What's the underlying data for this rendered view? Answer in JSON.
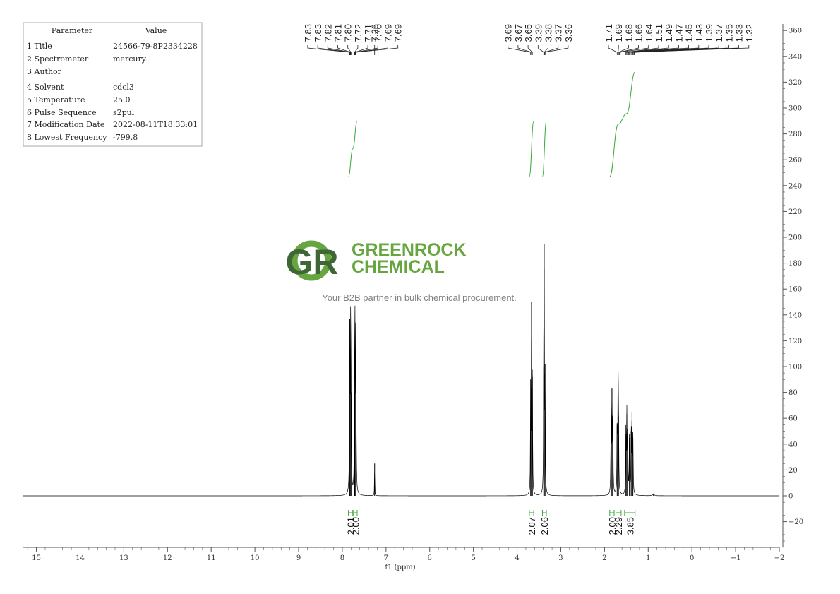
{
  "param_table": {
    "header": [
      "Parameter",
      "Value"
    ],
    "rows": [
      {
        "param": "1 Title",
        "value": "24566-79-8P2334228"
      },
      {
        "param": "2 Spectrometer",
        "value": "mercury"
      },
      {
        "param": "3 Author",
        "value": ""
      },
      {
        "param": "4 Solvent",
        "value": "cdcl3"
      },
      {
        "param": "5 Temperature",
        "value": "25.0"
      },
      {
        "param": "6 Pulse Sequence",
        "value": "s2pul"
      },
      {
        "param": "7 Modification Date",
        "value": "2022-08-11T18:33:01"
      },
      {
        "param": "8 Lowest Frequency",
        "value": "-799.8"
      }
    ]
  },
  "watermark": {
    "logo_letters": "GR",
    "line1": "GREENROCK",
    "line2": "CHEMICAL",
    "tagline": "Your B2B partner in bulk chemical procurement.",
    "green": "#5a9e2f",
    "dark": "#2f5a24"
  },
  "colors": {
    "spectrum": "#000000",
    "integral": "#3aa63a",
    "axis": "#555555"
  },
  "chart_data": {
    "type": "line",
    "title": "",
    "xlabel": "f1 (ppm)",
    "ylabel": "",
    "xlim": [
      15.3,
      -2.0
    ],
    "ylim": [
      -40,
      365
    ],
    "x_ticks": [
      15,
      14,
      13,
      12,
      11,
      10,
      9,
      8,
      7,
      6,
      5,
      4,
      3,
      2,
      1,
      0,
      -1,
      -2
    ],
    "x_tick_labels": [
      "15",
      "14",
      "13",
      "12",
      "11",
      "10",
      "9",
      "8",
      "7",
      "6",
      "5",
      "4",
      "3",
      "2",
      "1",
      "0",
      "−1",
      "−2"
    ],
    "y_ticks": [
      -20,
      0,
      20,
      40,
      60,
      80,
      100,
      120,
      140,
      160,
      180,
      200,
      220,
      240,
      260,
      280,
      300,
      320,
      340,
      360
    ],
    "grid": false,
    "peaks": [
      {
        "ppm": 7.83,
        "h": 137,
        "w": 0.006
      },
      {
        "ppm": 7.81,
        "h": 115,
        "w": 0.006
      },
      {
        "ppm": 7.8,
        "h": 80,
        "w": 0.006
      },
      {
        "ppm": 7.72,
        "h": 80,
        "w": 0.006
      },
      {
        "ppm": 7.71,
        "h": 115,
        "w": 0.006
      },
      {
        "ppm": 7.69,
        "h": 134,
        "w": 0.006
      },
      {
        "ppm": 7.26,
        "h": 25,
        "w": 0.004
      },
      {
        "ppm": 3.69,
        "h": 90,
        "w": 0.005
      },
      {
        "ppm": 3.67,
        "h": 150,
        "w": 0.005
      },
      {
        "ppm": 3.65,
        "h": 92,
        "w": 0.005
      },
      {
        "ppm": 3.39,
        "h": 100,
        "w": 0.005
      },
      {
        "ppm": 3.38,
        "h": 195,
        "w": 0.005
      },
      {
        "ppm": 3.36,
        "h": 102,
        "w": 0.005
      },
      {
        "ppm": 1.85,
        "h": 60,
        "w": 0.006
      },
      {
        "ppm": 1.83,
        "h": 83,
        "w": 0.006
      },
      {
        "ppm": 1.81,
        "h": 62,
        "w": 0.006
      },
      {
        "ppm": 1.71,
        "h": 55,
        "w": 0.006
      },
      {
        "ppm": 1.69,
        "h": 82,
        "w": 0.006
      },
      {
        "ppm": 1.68,
        "h": 62,
        "w": 0.006
      },
      {
        "ppm": 1.51,
        "h": 48,
        "w": 0.006
      },
      {
        "ppm": 1.49,
        "h": 63,
        "w": 0.006
      },
      {
        "ppm": 1.47,
        "h": 52,
        "w": 0.006
      },
      {
        "ppm": 1.43,
        "h": 45,
        "w": 0.006
      },
      {
        "ppm": 1.39,
        "h": 50,
        "w": 0.006
      },
      {
        "ppm": 1.37,
        "h": 65,
        "w": 0.006
      },
      {
        "ppm": 1.35,
        "h": 45,
        "w": 0.006
      },
      {
        "ppm": 0.88,
        "h": 1.5,
        "w": 0.02
      }
    ],
    "peak_label_groups": [
      {
        "labels": [
          "7.83",
          "7.83",
          "7.82",
          "7.81",
          "7.80",
          "7.72",
          "7.71",
          "7.70",
          "7.69",
          "7.69"
        ],
        "ppm": [
          7.83,
          7.83,
          7.82,
          7.81,
          7.8,
          7.72,
          7.71,
          7.7,
          7.69,
          7.69
        ]
      },
      {
        "labels": [
          "7.26"
        ],
        "ppm": [
          7.26
        ]
      },
      {
        "labels": [
          "3.69",
          "3.67",
          "3.65",
          "3.39",
          "3.38",
          "3.37",
          "3.36"
        ],
        "ppm": [
          3.69,
          3.67,
          3.65,
          3.39,
          3.38,
          3.37,
          3.36
        ]
      },
      {
        "labels": [
          "1.71",
          "1.69",
          "1.68",
          "1.66",
          "1.64",
          "1.51",
          "1.49",
          "1.47",
          "1.45",
          "1.43",
          "1.39",
          "1.37",
          "1.35",
          "1.33",
          "1.32"
        ],
        "ppm": [
          1.71,
          1.69,
          1.68,
          1.66,
          1.64,
          1.51,
          1.49,
          1.47,
          1.45,
          1.43,
          1.39,
          1.37,
          1.35,
          1.33,
          1.32
        ]
      }
    ],
    "integrals": [
      {
        "from": 7.86,
        "to": 7.76,
        "value": "2.01"
      },
      {
        "from": 7.74,
        "to": 7.66,
        "value": "2.00"
      },
      {
        "from": 3.72,
        "to": 3.62,
        "value": "2.07"
      },
      {
        "from": 3.42,
        "to": 3.33,
        "value": "2.06"
      },
      {
        "from": 1.88,
        "to": 1.78,
        "value": "2.00"
      },
      {
        "from": 1.74,
        "to": 1.62,
        "value": "2.29"
      },
      {
        "from": 1.54,
        "to": 1.3,
        "value": "3.85"
      }
    ],
    "integral_curves": [
      {
        "from": 7.86,
        "to": 7.66,
        "y0": 247,
        "y1": 290,
        "steps": [
          0.5,
          1.0
        ]
      },
      {
        "from": 3.72,
        "to": 3.62,
        "y0": 247,
        "y1": 290,
        "steps": [
          1.0
        ]
      },
      {
        "from": 3.42,
        "to": 3.33,
        "y0": 247,
        "y1": 290,
        "steps": [
          1.0
        ]
      },
      {
        "from": 1.88,
        "to": 1.3,
        "y0": 247,
        "y1": 328,
        "steps": [
          0.5,
          0.6,
          1.0
        ]
      }
    ]
  }
}
